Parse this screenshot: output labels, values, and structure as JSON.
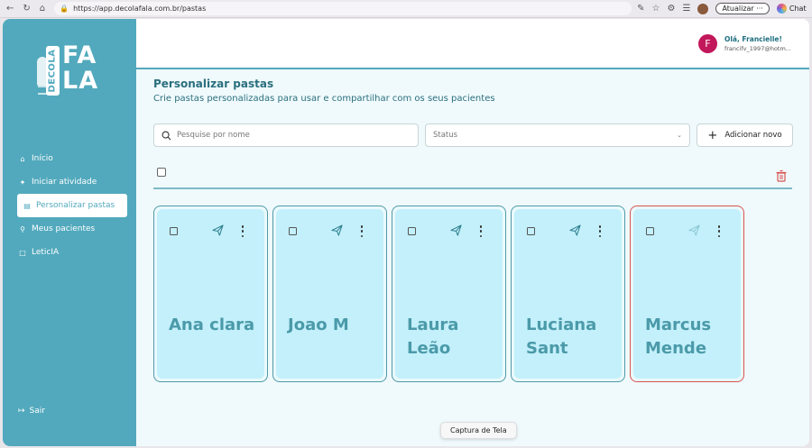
{
  "browser": {
    "url": "https://app.decolafala.com.br/pastas",
    "update_label": "Atualizar",
    "chat_label": "Chat"
  },
  "logo": {
    "vertical_text": "DECOLA",
    "line1": "FA",
    "line2": "LA"
  },
  "sidebar": {
    "items": [
      {
        "label": "Início",
        "icon": "home-icon"
      },
      {
        "label": "Iniciar atividade",
        "icon": "sparkle-icon"
      },
      {
        "label": "Personalizar pastas",
        "icon": "folder-icon",
        "active": true
      },
      {
        "label": "Meus pacientes",
        "icon": "search-icon"
      },
      {
        "label": "LeticIA",
        "icon": "chat-icon"
      }
    ],
    "logout_label": "Sair"
  },
  "user": {
    "initial": "F",
    "greeting": "Olá, Francielle!",
    "email": "francifv_1997@hotm..."
  },
  "page": {
    "title": "Personalizar pastas",
    "subtitle": "Crie pastas personalizadas para usar e compartilhar com os seus pacientes"
  },
  "toolbar": {
    "search_placeholder": "Pesquise por nome",
    "status_label": "Status",
    "add_label": "Adicionar novo"
  },
  "folders": [
    {
      "name": "Ana clara",
      "selected_border": false
    },
    {
      "name": "Joao M",
      "selected_border": false
    },
    {
      "name": "Laura Leão",
      "selected_border": false
    },
    {
      "name": "Luciana Sant",
      "selected_border": false
    },
    {
      "name": "Marcus Mende",
      "selected_border": true
    }
  ],
  "tooltip": "Captura de Tela",
  "colors": {
    "sidebar": "#52a9bd",
    "card_fill": "#c3f0fb",
    "card_border": "#4f9aa8",
    "highlight_border": "#d9534f",
    "avatar": "#c2185b"
  }
}
